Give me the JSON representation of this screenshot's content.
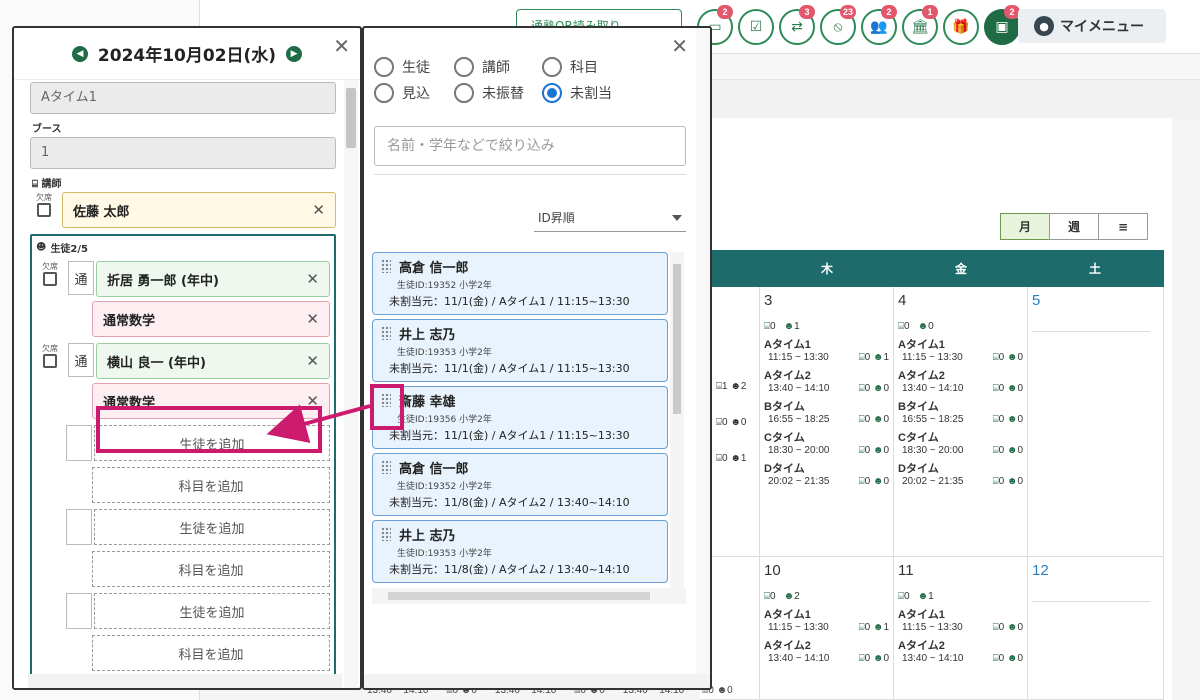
{
  "header": {
    "qr_label": "通塾QR読み取り",
    "icons": [
      {
        "name": "screen-icon",
        "glyph": "▭",
        "badge": "2"
      },
      {
        "name": "checklist-icon",
        "glyph": "☑",
        "badge": ""
      },
      {
        "name": "transfer-icon",
        "glyph": "⇄",
        "badge": "3"
      },
      {
        "name": "no-entry-icon",
        "glyph": "⦸",
        "badge": "23"
      },
      {
        "name": "group-icon",
        "glyph": "👥",
        "badge": "2"
      },
      {
        "name": "building-icon",
        "glyph": "🏛",
        "badge": "1"
      },
      {
        "name": "gift-icon",
        "glyph": "🎁",
        "badge": ""
      },
      {
        "name": "chat-icon",
        "glyph": "▣",
        "badge": "2"
      }
    ],
    "my_menu": "マイメニュー"
  },
  "left_panel": {
    "date": "2024年10月02日(水)",
    "time_slot_value": "Aタイム1",
    "booth_label": "ブース",
    "booth_value": "1",
    "teacher_label": "講師",
    "absent_label": "欠席",
    "teacher_name": "佐藤 太郎",
    "students_header": "生徒2/5",
    "attend_mark": "通",
    "students": [
      {
        "name": "折居 勇一郎 (年中)",
        "subject": "通常数学"
      },
      {
        "name": "横山 良一 (年中)",
        "subject": "通常数学"
      }
    ],
    "add_student_label": "生徒を追加",
    "add_subject_label": "科目を追加"
  },
  "right_panel": {
    "radios": [
      {
        "label": "生徒",
        "checked": false
      },
      {
        "label": "講師",
        "checked": false
      },
      {
        "label": "科目",
        "checked": false
      },
      {
        "label": "見込",
        "checked": false
      },
      {
        "label": "未振替",
        "checked": false
      },
      {
        "label": "未割当",
        "checked": true
      }
    ],
    "filter_placeholder": "名前・学年などで絞り込み",
    "sort_label": "ID昇順",
    "cards": [
      {
        "name": "高倉 信一郎",
        "sub": "生徒ID:19352 小学2年",
        "line": "未割当元：11/1(金) / Aタイム1 / 11:15~13:30"
      },
      {
        "name": "井上 志乃",
        "sub": "生徒ID:19353 小学2年",
        "line": "未割当元：11/1(金) / Aタイム1 / 11:15~13:30"
      },
      {
        "name": "斎藤 幸雄",
        "sub": "生徒ID:19356 小学2年",
        "line": "未割当元：11/1(金) / Aタイム1 / 11:15~13:30"
      },
      {
        "name": "高倉 信一郎",
        "sub": "生徒ID:19352 小学2年",
        "line": "未割当元：11/8(金) / Aタイム2 / 13:40~14:10"
      },
      {
        "name": "井上 志乃",
        "sub": "生徒ID:19353 小学2年",
        "line": "未割当元：11/8(金) / Aタイム2 / 13:40~14:10"
      }
    ]
  },
  "calendar": {
    "views": [
      "月",
      "週",
      "≡"
    ],
    "weekdays": [
      "木",
      "金",
      "土"
    ],
    "days": [
      {
        "num": "3",
        "counts": [
          "0",
          "1"
        ],
        "slots": [
          {
            "name": "Aタイム1",
            "time": "11:15 ~ 13:30",
            "c1": "0",
            "c2": "1"
          },
          {
            "name": "Aタイム2",
            "time": "13:40 ~ 14:10",
            "c1": "0",
            "c2": "0"
          },
          {
            "name": "Bタイム",
            "time": "16:55 ~ 18:25",
            "c1": "0",
            "c2": "0"
          },
          {
            "name": "Cタイム",
            "time": "18:30 ~ 20:00",
            "c1": "0",
            "c2": "0"
          },
          {
            "name": "Dタイム",
            "time": "20:02 ~ 21:35",
            "c1": "0",
            "c2": "0"
          }
        ]
      },
      {
        "num": "4",
        "counts": [
          "0",
          "0"
        ],
        "slots": [
          {
            "name": "Aタイム1",
            "time": "11:15 ~ 13:30",
            "c1": "0",
            "c2": "0"
          },
          {
            "name": "Aタイム2",
            "time": "13:40 ~ 14:10",
            "c1": "0",
            "c2": "0"
          },
          {
            "name": "Bタイム",
            "time": "16:55 ~ 18:25",
            "c1": "0",
            "c2": "0"
          },
          {
            "name": "Cタイム",
            "time": "18:30 ~ 20:00",
            "c1": "0",
            "c2": "0"
          },
          {
            "name": "Dタイム",
            "time": "20:02 ~ 21:35",
            "c1": "0",
            "c2": "0"
          }
        ]
      },
      {
        "num": "5"
      },
      {
        "num": "10",
        "counts": [
          "0",
          "2"
        ],
        "slots": [
          {
            "name": "Aタイム1",
            "time": "11:15 ~ 13:30",
            "c1": "0",
            "c2": "1"
          },
          {
            "name": "Aタイム2",
            "time": "13:40 ~ 14:10",
            "c1": "0",
            "c2": "0"
          }
        ]
      },
      {
        "num": "11",
        "counts": [
          "0",
          "1"
        ],
        "slots": [
          {
            "name": "Aタイム1",
            "time": "11:15 ~ 13:30",
            "c1": "0",
            "c2": "0"
          },
          {
            "name": "Aタイム2",
            "time": "13:40 ~ 14:10",
            "c1": "0",
            "c2": "0"
          }
        ]
      },
      {
        "num": "12"
      }
    ],
    "mid_counts": [
      [
        "1",
        "2"
      ],
      [
        "0",
        "0"
      ],
      [
        "0",
        "1"
      ]
    ],
    "bottom_times": [
      "13:40 ~ 14:10",
      "13:40 ~ 14:10",
      "13:40 ~ 14:10"
    ],
    "bottom_counts": [
      "0",
      "0"
    ]
  }
}
